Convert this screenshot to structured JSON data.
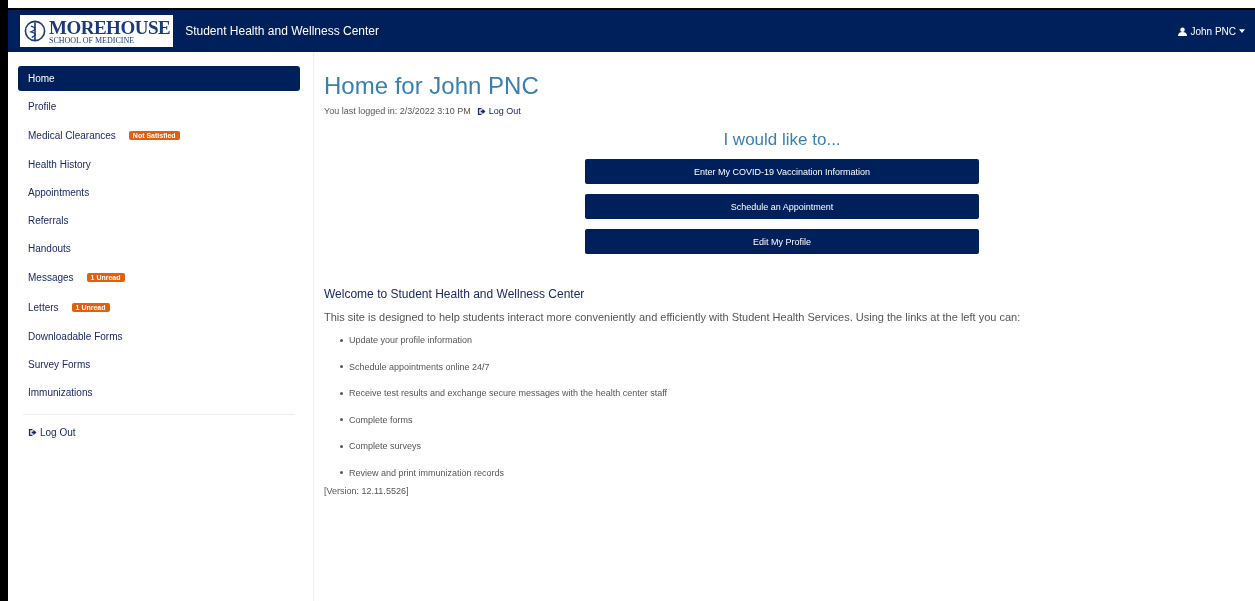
{
  "navbar": {
    "logo": {
      "name": "MOREHOUSE",
      "subtitle": "SCHOOL OF MEDICINE"
    },
    "title": "Student Health and Wellness Center",
    "user": "John PNC"
  },
  "sidebar": {
    "items": [
      {
        "label": "Home",
        "selected": true
      },
      {
        "label": "Profile",
        "selected": false
      },
      {
        "label": "Medical Clearances",
        "selected": false,
        "badge": "Not Satisfied"
      },
      {
        "label": "Health History",
        "selected": false
      },
      {
        "label": "Appointments",
        "selected": false
      },
      {
        "label": "Referrals",
        "selected": false
      },
      {
        "label": "Handouts",
        "selected": false
      },
      {
        "label": "Messages",
        "selected": false,
        "badge": "1 Unread"
      },
      {
        "label": "Letters",
        "selected": false,
        "badge": "1 Unread"
      },
      {
        "label": "Downloadable Forms",
        "selected": false
      },
      {
        "label": "Survey Forms",
        "selected": false
      },
      {
        "label": "Immunizations",
        "selected": false
      }
    ],
    "logout": "Log Out"
  },
  "main": {
    "heading": "Home for John PNC",
    "last_login": "You last logged in: 2/3/2022 3:10 PM",
    "logout": "Log Out",
    "actions_heading": "I would like to...",
    "actions": [
      "Enter My COVID-19 Vaccination Information",
      "Schedule an Appointment",
      "Edit My Profile"
    ],
    "welcome_heading": "Welcome to Student Health and Wellness Center",
    "intro": "This site is designed to help students interact more conveniently and efficiently with Student Health Services. Using the links at the left you can:",
    "features": [
      "Update your profile information",
      "Schedule appointments online 24/7",
      "Receive test results and exchange secure messages with the health center staff",
      "Complete forms",
      "Complete surveys",
      "Review and print immunization records"
    ],
    "version": "[Version: 12.11.5526]"
  }
}
